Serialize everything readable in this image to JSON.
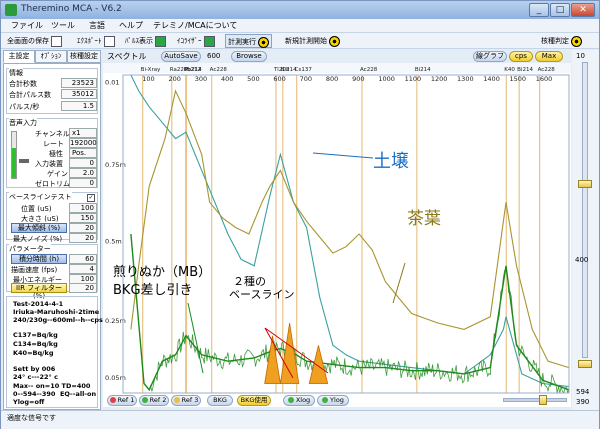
{
  "window": {
    "title": "Theremino MCA - V6.2"
  },
  "menu": [
    "ファイル",
    "ツール",
    "言語",
    "ヘルプ",
    "テレミノ/MCAについて"
  ],
  "toolbar": {
    "save_all": "全画面の保存",
    "export": "ｴｸｽﾎﾟｰﾄ",
    "pulse_display": "ﾊﾟﾙｽ表示",
    "equalizer": "ｲｺﾗｲｻﾞｰ",
    "measure": "計測実行",
    "new_measure": "新規計測開始",
    "nuclide_id": "核種判定"
  },
  "tabs": [
    "主設定",
    "ｵﾌﾟｼｮﾝ",
    "核種設定"
  ],
  "info": {
    "title": "情報",
    "total_seconds_label": "合計秒数",
    "total_seconds": "23523",
    "total_pulses_label": "合計パルス数",
    "total_pulses": "35012",
    "pps_label": "パルス/秒",
    "pps": "1.5"
  },
  "audio": {
    "title": "音声入力",
    "channel_label": "チャンネル",
    "channel": "x1",
    "rate_label": "レート",
    "rate": "192000",
    "polarity_label": "極性",
    "polarity": "Pos.",
    "device_label": "入力装置",
    "device": "0",
    "gain_label": "ゲイン",
    "gain": "2.0",
    "zero_label": "ゼロトリム",
    "zero": "0"
  },
  "baseline": {
    "title": "ベースラインテスト",
    "position_label": "位置 (uS)",
    "position": "100",
    "size_label": "大きさ (uS)",
    "size": "150",
    "max_slope_label": "最大傾斜 (%)",
    "max_slope": "20",
    "max_noise_label": "最大ノイズ (%)",
    "max_noise": "20"
  },
  "params": {
    "title": "パラメーター",
    "integ_label": "積分時間 (h)",
    "integ": "60",
    "speed_label": "描画速度 (fps)",
    "speed": "4",
    "min_energy_label": "最小エネルギー",
    "min_energy": "100",
    "iir_label": "IIR フィルター (%)",
    "iir": "20"
  },
  "notes": {
    "line1": "Test-2014-4-1",
    "line2": "Iriuka-Maruhoshi-2time",
    "line3": "240/230g--600ml--h--cps",
    "line4": "C137=Bq/kg",
    "line5": "C134=Bq/kg",
    "line6": "K40=Bq/kg",
    "line7": "Sett by 006",
    "line8": "24° c---22° c",
    "line9": "Max-- on=10 TD=400",
    "line10": "0--594--390  EQ--all-on",
    "line11": "Ylog=off"
  },
  "chart_top": {
    "spectrum": "スペクトル",
    "autosave": "AutoSave",
    "autosave_val": "600",
    "browse": "Browse",
    "line_graph": "線グラフ",
    "cps": "cps",
    "max": "Max"
  },
  "right_scale": {
    "top": "10",
    "mid": "400",
    "lower1": "594",
    "lower2": "390"
  },
  "bottom": {
    "ref1": "Ref 1",
    "ref2": "Ref 2",
    "ref3": "Ref 3",
    "bkg": "BKG",
    "bkg_use": "BKG使用",
    "xlog": "Xlog",
    "ylog": "Ylog"
  },
  "status": "適度な信号です",
  "annotations": {
    "soil": "土壌",
    "tea": "茶葉",
    "bran": "煎りぬか（MB）",
    "bkg_sub": "BKG差し引き",
    "baseline_two": "２種の",
    "baseline_word": "ベースライン"
  },
  "colors": {
    "soil": "#1a6fc4",
    "tea": "#8a7a1c",
    "bran": "#1d8a1d",
    "baseline_fill": "#f0a020",
    "gridline": "#e8c48a"
  },
  "chart_data": {
    "type": "line",
    "x_tick_labels": [
      "100",
      "200",
      "300",
      "400",
      "500",
      "600",
      "700",
      "800",
      "900",
      "1000",
      "1100",
      "1200",
      "1300",
      "1400",
      "1500",
      "1600"
    ],
    "y_tick_labels": [
      "0.01",
      "0.75m",
      "0.5m",
      "0.25m",
      "0.05m"
    ],
    "xlim": [
      0,
      1700
    ],
    "ylim": [
      0,
      0.01
    ],
    "nuclide_labels": [
      {
        "name": "Bi-Xray",
        "energy": 75
      },
      {
        "name": "Ra226",
        "energy": 186
      },
      {
        "name": "Pb214",
        "energy": 242
      },
      {
        "name": "Pb212",
        "energy": 239
      },
      {
        "name": "Ac228",
        "energy": 338
      },
      {
        "name": "Tl208",
        "energy": 583
      },
      {
        "name": "Bi214",
        "energy": 609
      },
      {
        "name": "Cs137",
        "energy": 662
      },
      {
        "name": "Ac228",
        "energy": 911
      },
      {
        "name": "Bi214",
        "energy": 1120
      },
      {
        "name": "K40",
        "energy": 1461
      },
      {
        "name": "Bi214",
        "energy": 1510
      },
      {
        "name": "Ac228",
        "energy": 1588
      }
    ],
    "series": [
      {
        "name": "土壌",
        "color": "#3aa0a0",
        "x": [
          30,
          60,
          100,
          150,
          200,
          240,
          300,
          350,
          400,
          450,
          500,
          560,
          600,
          650,
          700,
          750,
          800,
          850,
          900,
          1000,
          1100,
          1200,
          1300,
          1400,
          1450,
          1460,
          1480,
          1520,
          1600,
          1700
        ],
        "y": [
          0.01,
          0.0095,
          0.009,
          0.0085,
          0.008,
          0.0082,
          0.007,
          0.006,
          0.005,
          0.0042,
          0.004,
          0.0062,
          0.0075,
          0.006,
          0.0052,
          0.003,
          0.0015,
          0.0012,
          0.001,
          0.0009,
          0.0008,
          0.0007,
          0.0006,
          0.0012,
          0.002,
          0.0024,
          0.0018,
          0.0006,
          0.0003,
          0.0002
        ]
      },
      {
        "name": "茶葉",
        "color": "#a89530",
        "x": [
          30,
          60,
          100,
          160,
          200,
          240,
          300,
          330,
          380,
          430,
          480,
          530,
          560,
          600,
          650,
          700,
          760,
          800,
          850,
          900,
          950,
          1000,
          1050,
          1100,
          1200,
          1300,
          1400,
          1460,
          1500,
          1560,
          1620,
          1700
        ],
        "y": [
          0.002,
          0.004,
          0.0065,
          0.008,
          0.0095,
          0.0088,
          0.0075,
          0.006,
          0.0055,
          0.0052,
          0.005,
          0.006,
          0.0065,
          0.007,
          0.006,
          0.0054,
          0.0048,
          0.0044,
          0.0046,
          0.005,
          0.0045,
          0.0035,
          0.003,
          0.0025,
          0.0022,
          0.002,
          0.0024,
          0.006,
          0.004,
          0.002,
          0.001,
          0.0008
        ]
      },
      {
        "name": "煎りぬか（MB） BKG差し引き",
        "color": "#1d8a1d",
        "x": [
          30,
          80,
          100,
          150,
          200,
          240,
          300,
          400,
          500,
          560,
          600,
          660,
          700,
          800,
          900,
          1000,
          1100,
          1200,
          1300,
          1400,
          1460,
          1500,
          1600,
          1700
        ],
        "y": [
          0.005,
          0.0003,
          0.0001,
          0.001,
          0.0012,
          0.0018,
          0.0012,
          0.001,
          0.0011,
          0.0013,
          0.0014,
          0.0012,
          0.001,
          0.0009,
          0.0008,
          0.0008,
          0.0007,
          0.0007,
          0.0006,
          0.0008,
          0.004,
          0.0015,
          0.0004,
          0.0001
        ]
      }
    ]
  }
}
